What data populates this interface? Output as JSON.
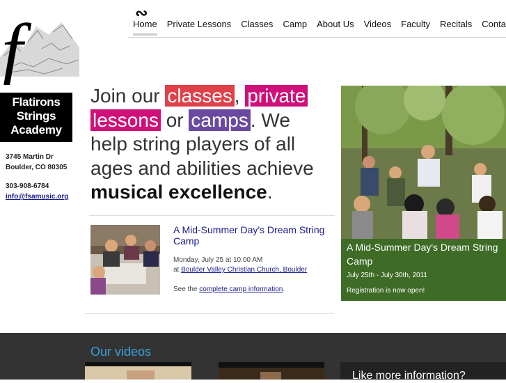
{
  "brand": {
    "logo_glyph": "f",
    "name_lines": [
      "Flatirons",
      "Strings",
      "Academy"
    ]
  },
  "address": {
    "line1": "3745 Martin Dr",
    "line2": "Boulder, CO 80305"
  },
  "contact": {
    "phone": "303-908-6784",
    "email": "info@fsamusic.org"
  },
  "nav": {
    "mark": "∾",
    "items": [
      "Home",
      "Private Lessons",
      "Classes",
      "Camp",
      "About Us",
      "Videos",
      "Faculty",
      "Recitals",
      "Contact"
    ],
    "active": "Home"
  },
  "hero": {
    "t1": "Join our ",
    "hl1": "classes",
    "t2": ", ",
    "hl2": "private",
    "hl3": "lessons",
    "t3": " or ",
    "hl4": "camps",
    "t4": ". We help string players of all ages and abilities achieve ",
    "bold": "musical excellence",
    "t5": "."
  },
  "event": {
    "title": "A Mid-Summer Day's Dream String Camp",
    "date": "Monday, July 25 at 10:00 AM",
    "venue_prefix": "at ",
    "venue": "Boulder Valley Christian Church, Boulder",
    "see_prefix": "See the ",
    "see_link": "complete camp information",
    "see_suffix": "."
  },
  "feature": {
    "title": "A Mid-Summer Day's Dream String Camp",
    "dates": "July 25th - July 30th, 2011",
    "registration": "Registration is now open!"
  },
  "footer": {
    "videos_title": "Our videos",
    "info_title": "Like more information?"
  },
  "colors": {
    "classes": "#e0404a",
    "private_lessons": "#d0107a",
    "camps": "#6a4aa0",
    "feature_green": "#3e6b26",
    "footer_bg": "#333333",
    "videos_title": "#3aa0d8"
  }
}
